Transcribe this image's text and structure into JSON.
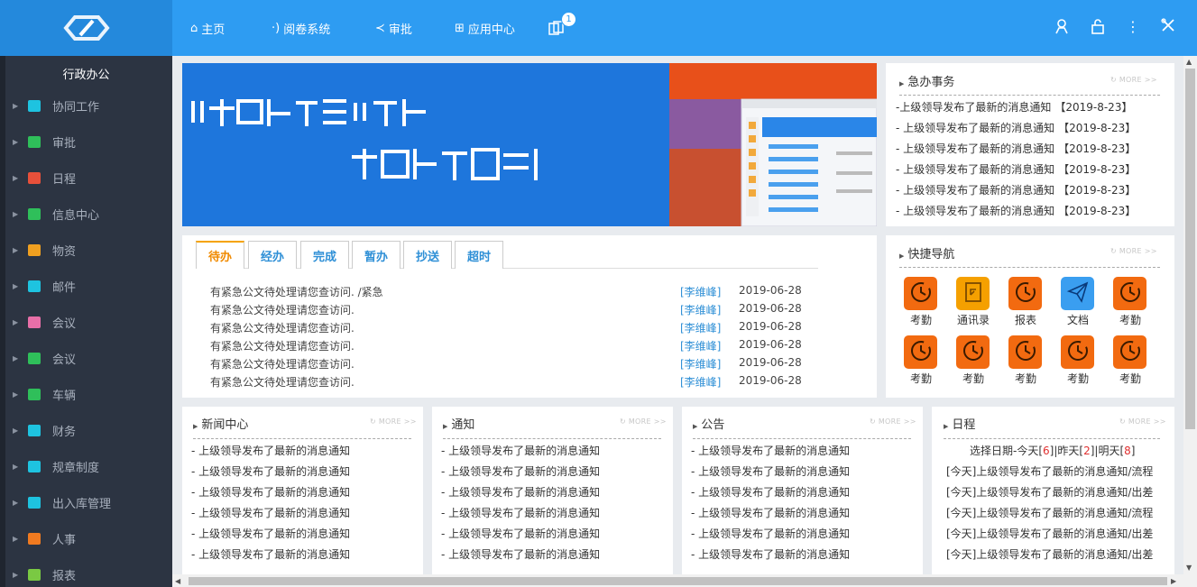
{
  "header": {
    "nav": [
      {
        "label": "主页",
        "icon": "home-icon"
      },
      {
        "label": "阅卷系统",
        "icon": "signal-icon"
      },
      {
        "label": "审批",
        "icon": "share-icon"
      },
      {
        "label": "应用中心",
        "icon": "apps-icon"
      }
    ],
    "notify_count": "1",
    "right_icons": [
      "user-icon",
      "lock-icon",
      "more-vertical-icon",
      "tools-icon"
    ]
  },
  "sidebar": {
    "title": "行政办公",
    "items": [
      {
        "label": "协同工作",
        "icon": "cube-icon",
        "color": "#1ec3e0"
      },
      {
        "label": "审批",
        "icon": "flow-icon",
        "color": "#2fbf5a"
      },
      {
        "label": "日程",
        "icon": "calendar-icon",
        "color": "#e8503a"
      },
      {
        "label": "信息中心",
        "icon": "speaker-icon",
        "color": "#2fbf5a"
      },
      {
        "label": "物资",
        "icon": "goods-icon",
        "color": "#f0a020"
      },
      {
        "label": "邮件",
        "icon": "cube-icon",
        "color": "#1ec3e0"
      },
      {
        "label": "会议",
        "icon": "meeting-icon",
        "color": "#e86fa8"
      },
      {
        "label": "会议",
        "icon": "layers-icon",
        "color": "#2fbf5a"
      },
      {
        "label": "车辆",
        "icon": "car-icon",
        "color": "#2fbf5a"
      },
      {
        "label": "财务",
        "icon": "cube-icon",
        "color": "#1ec3e0"
      },
      {
        "label": "规章制度",
        "icon": "cube-icon",
        "color": "#1ec3e0"
      },
      {
        "label": "出入库管理",
        "icon": "cube-icon",
        "color": "#1ec3e0"
      },
      {
        "label": "人事",
        "icon": "person-folder-icon",
        "color": "#f07a20"
      },
      {
        "label": "报表",
        "icon": "folder-icon",
        "color": "#7ac943"
      }
    ]
  },
  "urgent": {
    "title": "急办事务",
    "more": "MORE >>",
    "items": [
      {
        "text": "-上级领导发布了最新的消息通知",
        "date": "【2019-8-23】"
      },
      {
        "text": "- 上级领导发布了最新的消息通知",
        "date": "【2019-8-23】"
      },
      {
        "text": "- 上级领导发布了最新的消息通知",
        "date": "【2019-8-23】"
      },
      {
        "text": "- 上级领导发布了最新的消息通知",
        "date": "【2019-8-23】"
      },
      {
        "text": "- 上级领导发布了最新的消息通知",
        "date": "【2019-8-23】"
      },
      {
        "text": "- 上级领导发布了最新的消息通知",
        "date": "【2019-8-23】"
      }
    ]
  },
  "todo": {
    "tabs": [
      "待办",
      "经办",
      "完成",
      "暂办",
      "抄送",
      "超时"
    ],
    "rows": [
      {
        "text": "有紧急公文待处理请您查访问. /紧急",
        "name": "[李维峰]",
        "date": "2019-06-28"
      },
      {
        "text": "有紧急公文待处理请您查访问.",
        "name": "[李维峰]",
        "date": "2019-06-28"
      },
      {
        "text": "有紧急公文待处理请您查访问.",
        "name": "[李维峰]",
        "date": "2019-06-28"
      },
      {
        "text": "有紧急公文待处理请您查访问.",
        "name": "[李维峰]",
        "date": "2019-06-28"
      },
      {
        "text": "有紧急公文待处理请您查访问.",
        "name": "[李维峰]",
        "date": "2019-06-28"
      },
      {
        "text": "有紧急公文待处理请您查访问.",
        "name": "[李维峰]",
        "date": "2019-06-28"
      }
    ]
  },
  "quick": {
    "title": "快捷导航",
    "more": "MORE >>",
    "items": [
      {
        "label": "考勤",
        "icon": "clock-icon",
        "color": "#f26a10"
      },
      {
        "label": "通讯录",
        "icon": "contacts-icon",
        "color": "#f5a000"
      },
      {
        "label": "报表",
        "icon": "clock-icon",
        "color": "#f26a10"
      },
      {
        "label": "文档",
        "icon": "paper-plane-icon",
        "color": "#3a9ef0"
      },
      {
        "label": "考勤",
        "icon": "clock-icon",
        "color": "#f26a10"
      },
      {
        "label": "考勤",
        "icon": "clock-icon",
        "color": "#f26a10"
      },
      {
        "label": "考勤",
        "icon": "clock-icon",
        "color": "#f26a10"
      },
      {
        "label": "考勤",
        "icon": "clock-icon",
        "color": "#f26a10"
      },
      {
        "label": "考勤",
        "icon": "clock-icon",
        "color": "#f26a10"
      },
      {
        "label": "考勤",
        "icon": "clock-icon",
        "color": "#f26a10"
      }
    ]
  },
  "bottom": [
    {
      "title": "新闻中心",
      "more": "MORE >>",
      "items": [
        "- 上级领导发布了最新的消息通知",
        "- 上级领导发布了最新的消息通知",
        "- 上级领导发布了最新的消息通知",
        "- 上级领导发布了最新的消息通知",
        "- 上级领导发布了最新的消息通知",
        "- 上级领导发布了最新的消息通知"
      ]
    },
    {
      "title": "通知",
      "more": "MORE >>",
      "items": [
        "- 上级领导发布了最新的消息通知",
        "- 上级领导发布了最新的消息通知",
        "- 上级领导发布了最新的消息通知",
        "- 上级领导发布了最新的消息通知",
        "- 上级领导发布了最新的消息通知",
        "- 上级领导发布了最新的消息通知"
      ]
    },
    {
      "title": "公告",
      "more": "MORE >>",
      "items": [
        "- 上级领导发布了最新的消息通知",
        "- 上级领导发布了最新的消息通知",
        "- 上级领导发布了最新的消息通知",
        "- 上级领导发布了最新的消息通知",
        "- 上级领导发布了最新的消息通知",
        "- 上级领导发布了最新的消息通知"
      ]
    }
  ],
  "schedule": {
    "title": "日程",
    "more": "MORE >>",
    "select_prefix": "选择日期-今天",
    "today": "6",
    "yesterday_label": "|昨天",
    "yesterday": "2",
    "tomorrow_label": "|明天",
    "tomorrow": "8",
    "items": [
      "[今天]上级领导发布了最新的消息通知/流程",
      "[今天]上级领导发布了最新的消息通知/出差",
      "[今天]上级领导发布了最新的消息通知/流程",
      "[今天]上级领导发布了最新的消息通知/出差",
      "[今天]上级领导发布了最新的消息通知/出差"
    ]
  }
}
